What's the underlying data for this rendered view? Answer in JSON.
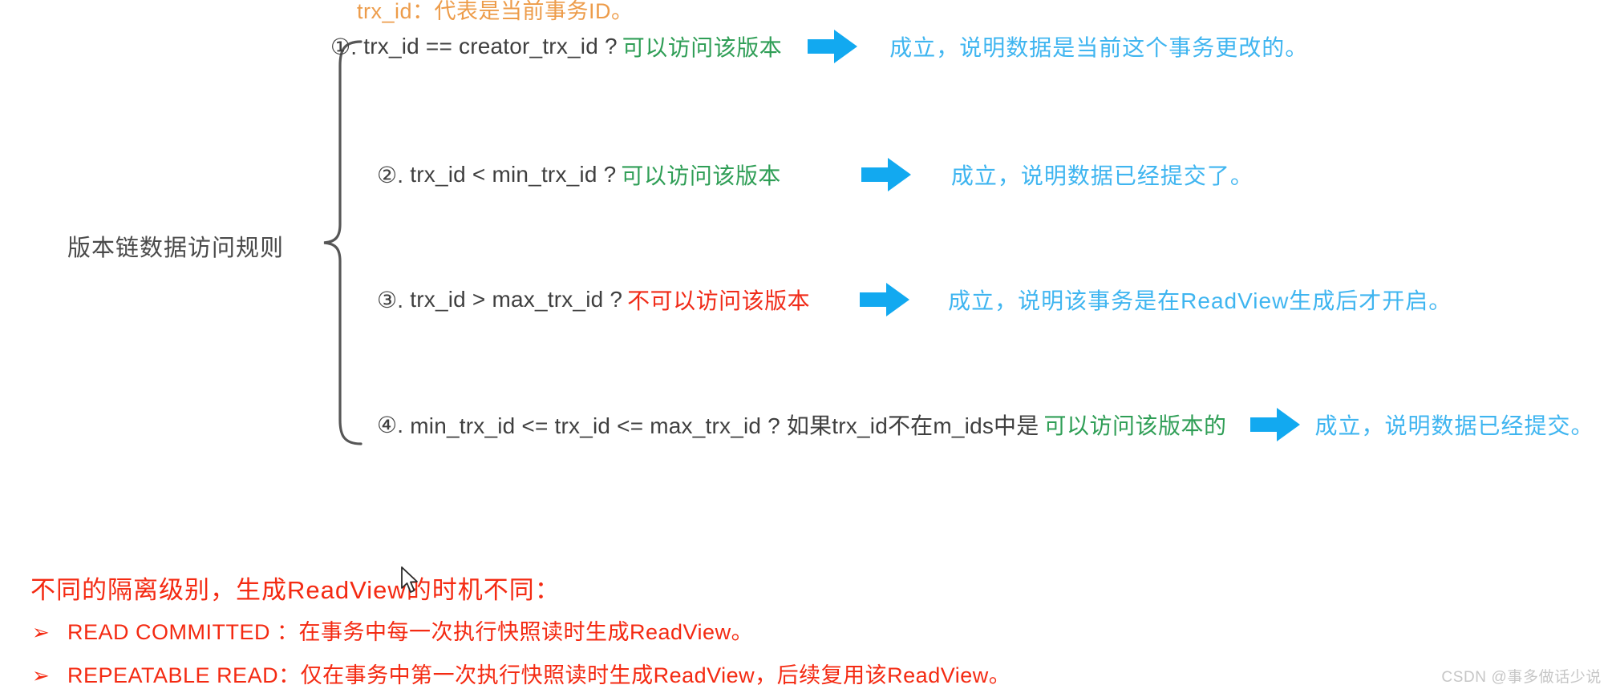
{
  "legend": {
    "text": "trx_id：代表是当前事务ID。",
    "color": "#ed9c4a"
  },
  "left_label": {
    "text": "版本链数据访问规则"
  },
  "rules": [
    {
      "index": "①.",
      "condition": "trx_id  == creator_trx_id ?",
      "verdict": "可以访问该版本",
      "verdict_type": "allow",
      "arrow": "right-arrow-icon",
      "conclusion": "成立，说明数据是当前这个事务更改的。"
    },
    {
      "index": "②.",
      "condition": "trx_id < min_trx_id ?",
      "verdict": "可以访问该版本",
      "verdict_type": "allow",
      "arrow": "right-arrow-icon",
      "conclusion": "成立，说明数据已经提交了。"
    },
    {
      "index": "③.",
      "condition": "trx_id > max_trx_id ?",
      "verdict": "不可以访问该版本",
      "verdict_type": "deny",
      "arrow": "right-arrow-icon",
      "conclusion": "成立，说明该事务是在ReadView生成后才开启。"
    },
    {
      "index": "④.",
      "condition": "min_trx_id <= trx_id <= max_trx_id ?  如果trx_id不在m_ids中是",
      "verdict": "可以访问该版本的",
      "verdict_type": "allow",
      "arrow": "right-arrow-icon",
      "conclusion": "成立，说明数据已经提交。"
    }
  ],
  "isolation": {
    "heading": "不同的隔离级别，生成ReadView的时机不同：",
    "bullets": [
      {
        "marker": "➢",
        "text": "READ COMMITTED ：在事务中每一次执行快照读时生成ReadView。"
      },
      {
        "marker": "➢",
        "text": "REPEATABLE READ：仅在事务中第一次执行快照读时生成ReadView，后续复用该ReadView。"
      }
    ]
  },
  "watermark": {
    "text": "CSDN @事多做话少说"
  },
  "colors": {
    "orange": "#ed9c4a",
    "green": "#2f9e56",
    "red_deny": "#f02a17",
    "blue_conclusion": "#3fb5f0",
    "arrow_blue": "#12a9f0",
    "heading_red": "#f42a12",
    "label_gray": "#4a4a4a",
    "watermark_gray": "#c6c6c6"
  }
}
